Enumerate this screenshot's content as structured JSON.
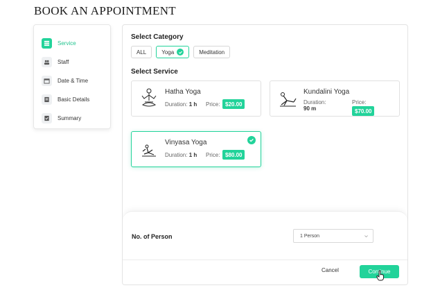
{
  "page": {
    "title": "BOOK AN APPOINTMENT"
  },
  "steps": [
    {
      "label": "Service",
      "icon": "service-icon",
      "active": true
    },
    {
      "label": "Staff",
      "icon": "staff-icon",
      "active": false
    },
    {
      "label": "Date & Time",
      "icon": "calendar-icon",
      "active": false
    },
    {
      "label": "Basic Details",
      "icon": "details-icon",
      "active": false
    },
    {
      "label": "Summary",
      "icon": "summary-icon",
      "active": false
    }
  ],
  "category": {
    "title": "Select Category",
    "options": [
      {
        "label": "ALL",
        "selected": false
      },
      {
        "label": "Yoga",
        "selected": true
      },
      {
        "label": "Meditation",
        "selected": false
      }
    ]
  },
  "service": {
    "title": "Select Service",
    "duration_label": "Duration:",
    "price_label": "Price:",
    "items": [
      {
        "name": "Hatha Yoga",
        "duration": "1 h",
        "price": "$20.00",
        "selected": false,
        "icon": "meditation-pose-icon"
      },
      {
        "name": "Kundalini Yoga",
        "duration": "90 m",
        "price": "$70.00",
        "selected": false,
        "icon": "yoga-stretch-icon"
      },
      {
        "name": "Vinyasa Yoga",
        "duration": "1 h",
        "price": "$80.00",
        "selected": true,
        "icon": "yoga-flow-icon"
      }
    ]
  },
  "persons": {
    "label": "No. of Person",
    "selected": "1 Person"
  },
  "actions": {
    "cancel": "Cancel",
    "continue": "Continue"
  },
  "colors": {
    "accent": "#22d39a",
    "border": "#e3e3e3"
  }
}
